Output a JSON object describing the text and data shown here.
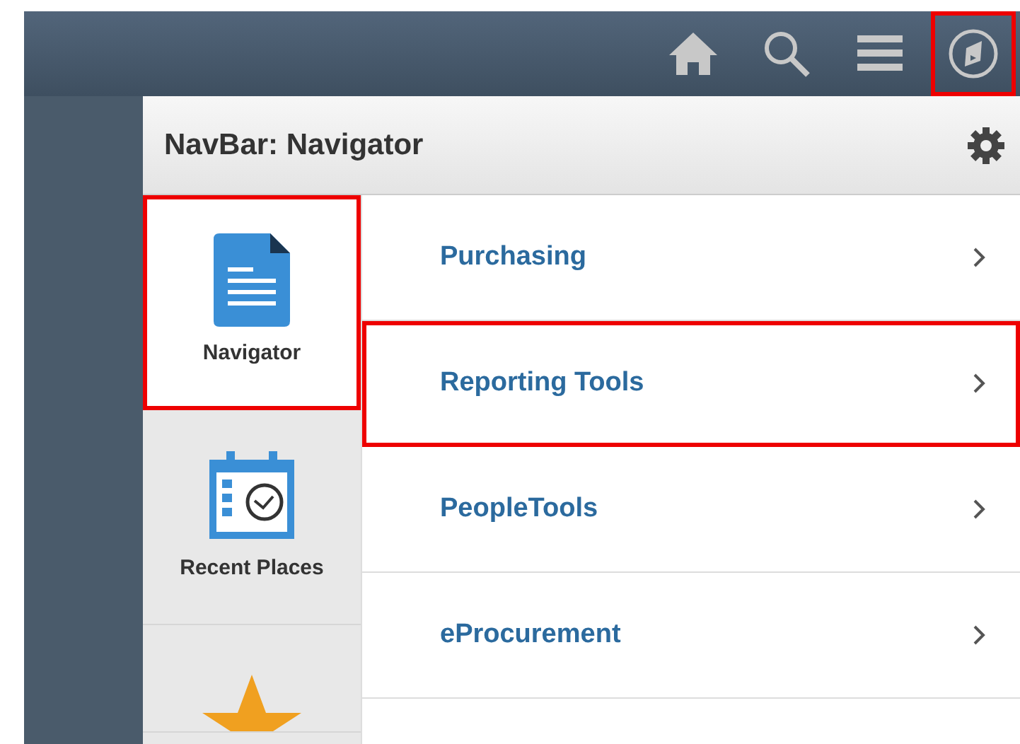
{
  "top_bar": {
    "buttons": [
      {
        "kind": "home",
        "highlighted": false
      },
      {
        "kind": "search",
        "highlighted": false
      },
      {
        "kind": "menu",
        "highlighted": false
      },
      {
        "kind": "navbar",
        "highlighted": true
      }
    ]
  },
  "panel": {
    "title": "NavBar: Navigator"
  },
  "tiles": [
    {
      "kind": "navigator",
      "label": "Navigator",
      "selected": true,
      "highlighted": true
    },
    {
      "kind": "recent",
      "label": "Recent Places",
      "selected": false,
      "highlighted": false
    },
    {
      "kind": "favorites",
      "selected": false,
      "highlighted": false
    }
  ],
  "menu_items": [
    {
      "label": "Purchasing",
      "highlighted": false
    },
    {
      "label": "Reporting Tools",
      "highlighted": true
    },
    {
      "label": "PeopleTools",
      "highlighted": false
    },
    {
      "label": "eProcurement",
      "highlighted": false
    }
  ]
}
